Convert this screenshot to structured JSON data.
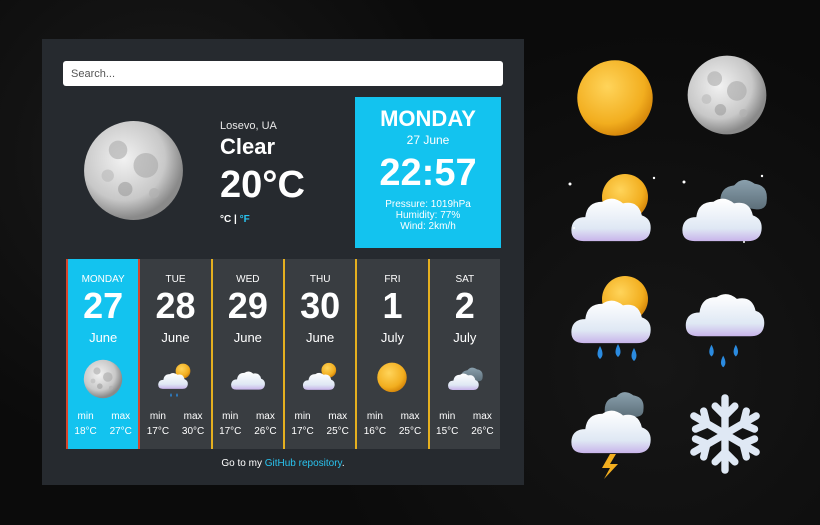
{
  "search": {
    "placeholder": "Search..."
  },
  "current": {
    "location": "Losevo, UA",
    "condition": "Clear",
    "temperature": "20°C",
    "unit_c": "°C",
    "unit_sep": " | ",
    "unit_f": "°F"
  },
  "today": {
    "day_name": "MONDAY",
    "date": "27 June",
    "time": "22:57",
    "pressure": "Pressure: 1019hPa",
    "humidity": "Humidity: 77%",
    "wind": "Wind: 2km/h"
  },
  "forecast": [
    {
      "day": "MONDAY",
      "num": "27",
      "month": "June",
      "icon": "moon-icon",
      "min_label": "min",
      "max_label": "max",
      "min": "18°C",
      "max": "27°C"
    },
    {
      "day": "TUE",
      "num": "28",
      "month": "June",
      "icon": "sun-cloud-rain-icon",
      "min_label": "min",
      "max_label": "max",
      "min": "17°C",
      "max": "30°C"
    },
    {
      "day": "WED",
      "num": "29",
      "month": "June",
      "icon": "cloud-icon",
      "min_label": "min",
      "max_label": "max",
      "min": "17°C",
      "max": "26°C"
    },
    {
      "day": "THU",
      "num": "30",
      "month": "June",
      "icon": "sun-cloud-icon",
      "min_label": "min",
      "max_label": "max",
      "min": "17°C",
      "max": "25°C"
    },
    {
      "day": "FRI",
      "num": "1",
      "month": "July",
      "icon": "sun-icon",
      "min_label": "min",
      "max_label": "max",
      "min": "16°C",
      "max": "25°C"
    },
    {
      "day": "SAT",
      "num": "2",
      "month": "July",
      "icon": "dark-cloud-icon",
      "min_label": "min",
      "max_label": "max",
      "min": "15°C",
      "max": "26°C"
    }
  ],
  "footer": {
    "prefix": "Go to my ",
    "link": "GitHub repository",
    "suffix": "."
  },
  "colors": {
    "accent": "#13c3ef",
    "panel": "#262a2f",
    "day_bg": "#393d41",
    "divider": "#e6b01f",
    "active_border": "#d6452c"
  }
}
